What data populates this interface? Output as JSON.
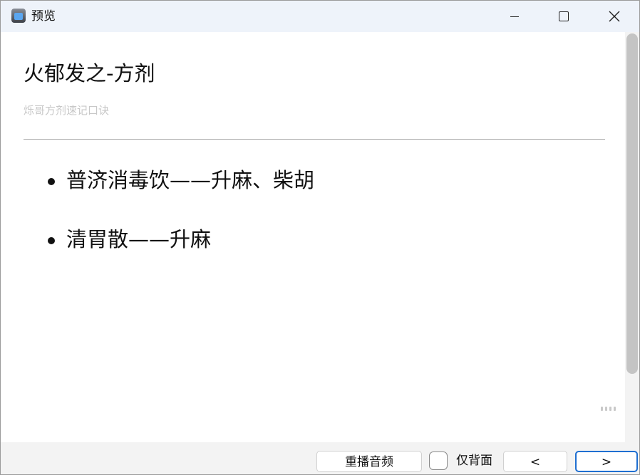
{
  "window": {
    "title": "预览",
    "app_icon": "app-icon",
    "controls": [
      "minimize-icon",
      "maximize-icon",
      "close-icon"
    ]
  },
  "card": {
    "title": "火郁发之-方剂",
    "subtitle": "烁哥方剂速记口诀",
    "items": [
      "普济消毒饮——升麻、柴胡",
      "清胃散——升麻"
    ]
  },
  "bottom_bar": {
    "replay_label": "重播音频",
    "back_only_label": "仅背面",
    "back_only_checked": false,
    "prev_label": "<",
    "next_label": ">"
  },
  "colors": {
    "titlebar_bg": "#eef3fa",
    "accent_border": "#1f6fd1",
    "subtitle_text": "#c8c8c8"
  }
}
